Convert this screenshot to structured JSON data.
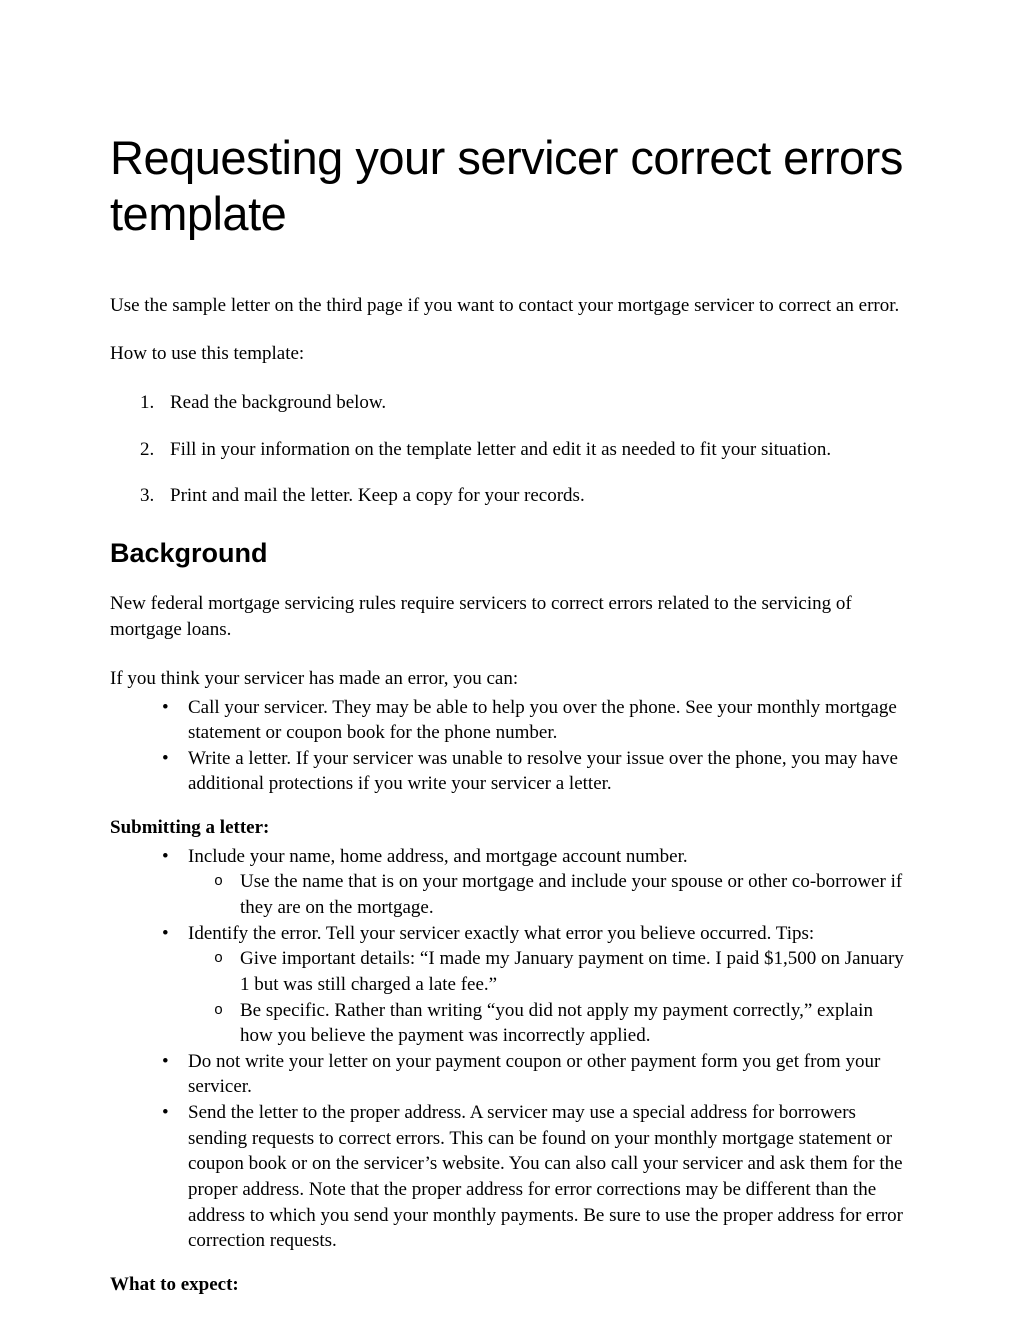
{
  "title": "Requesting your servicer correct errors template",
  "intro": "Use the sample letter on the third page if you want to contact your mortgage servicer to correct an error.",
  "howToLabel": "How to use this template:",
  "steps": [
    "Read the background below.",
    "Fill in your information on the template letter and edit it as needed to fit your situation.",
    "Print and mail the letter. Keep a copy for your records."
  ],
  "background": {
    "heading": "Background",
    "para1": "New federal mortgage servicing rules require servicers to correct errors related to the servicing of mortgage loans.",
    "para2": "If you think your servicer has made an error, you can:",
    "options": [
      "Call your servicer. They may be able to help you over the phone. See your monthly mortgage statement or coupon book for the phone number.",
      "Write a letter. If your servicer was unable to resolve your issue over the phone, you may have additional protections if you write your servicer a letter."
    ]
  },
  "submitting": {
    "heading": "Submitting a letter:",
    "items": {
      "i1": "Include your name, home address, and mortgage account number.",
      "i1sub1": "Use the name that is on your mortgage and include your spouse or other co-borrower if they are on the mortgage.",
      "i2": "Identify the error. Tell your servicer exactly what error you believe occurred. Tips:",
      "i2sub1": "Give important details:  “I made my January payment on time. I paid $1,500 on January 1 but was still charged a late fee.”",
      "i2sub2": "Be specific. Rather than writing “you did not apply my payment correctly,” explain how you believe the payment was incorrectly applied.",
      "i3": "Do not write your letter on your payment coupon or other payment form you get from your servicer.",
      "i4": "Send the letter to the proper address. A servicer may use a special address for borrowers sending requests to correct errors. This can be found on your monthly mortgage statement or coupon book or on the servicer’s website. You can also call your servicer and ask them for the proper address. Note that the proper address for error corrections may be different than the address to which you send your monthly payments. Be sure to use the proper address for error correction requests."
    }
  },
  "expect": {
    "heading": "What to expect:"
  }
}
